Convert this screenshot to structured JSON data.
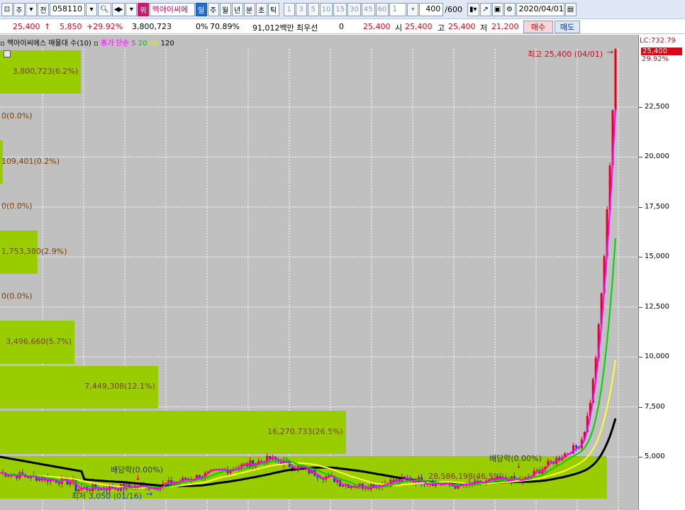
{
  "toolbar": {
    "market": "주",
    "prev": "전",
    "code": "058110",
    "warn": "위",
    "stock_name": "멕아이씨에",
    "periods": [
      "일",
      "주",
      "월",
      "년",
      "분",
      "초",
      "틱"
    ],
    "intervals": [
      "1",
      "3",
      "5",
      "10",
      "15",
      "30",
      "45",
      "60"
    ],
    "count_select": "1",
    "bar_count": "400",
    "bar_total": "/600",
    "date": "2020/04/01"
  },
  "quote": {
    "price": "25,400",
    "change": "5,850",
    "change_pct": "+29.92%",
    "volume": "3,800,723",
    "turnover_label": "0%",
    "turnover": "70.89%",
    "amount": "91,012백만",
    "best_quote": "최우선",
    "best_qty": "0",
    "best_price": "25,400",
    "open_label": "시",
    "open": "25,400",
    "high_label": "고",
    "high": "25,400",
    "low_label": "저",
    "low": "21,200",
    "buy_label": "매수",
    "sell_label": "매도"
  },
  "legend": {
    "title": "멕아이씨에스 매물대 수(10)",
    "ma_type": "종가 단순",
    "ma_periods": [
      "5",
      "20",
      "60",
      "120"
    ],
    "colors": {
      "ma5": "#ff00ff",
      "ma20": "#00c000",
      "ma60": "#e6e600",
      "ma120": "#000000"
    }
  },
  "axis": {
    "lc": "LC:732.79",
    "price_tag": "25,400",
    "pct": "29.92%",
    "ticks": [
      "22,500",
      "20,000",
      "17,500",
      "15,000",
      "12,500",
      "10,000",
      "7,500",
      "5,000"
    ]
  },
  "annotations": {
    "high": "최고 25,400 (04/01)",
    "low": "최저 3,050 (01/16)",
    "dividend1": "배당락(0.00%)",
    "dividend2": "배당락(0.00%)",
    "low_band_overlap": "28,586,198(46.5%)(  397,  0  ,175,0%)"
  },
  "chart_data": {
    "type": "volume-profile",
    "title": "멕아이씨에스 매물대 수(10)",
    "ylim": [
      2500,
      26000
    ],
    "y_ticks": [
      22500,
      20000,
      17500,
      15000,
      12500,
      10000,
      7500,
      5000
    ],
    "bands": [
      {
        "label": "3,800,723(6.2%)",
        "volume": 3800723,
        "pct": 6.2
      },
      {
        "label": "0(0.0%)",
        "volume": 0,
        "pct": 0.0
      },
      {
        "label": "109,401(0.2%)",
        "volume": 109401,
        "pct": 0.2
      },
      {
        "label": "0(0.0%)",
        "volume": 0,
        "pct": 0.0
      },
      {
        "label": "1,753,380(2.9%)",
        "volume": 1753380,
        "pct": 2.9
      },
      {
        "label": "0(0.0%)",
        "volume": 0,
        "pct": 0.0
      },
      {
        "label": "3,496,660(5.7%)",
        "volume": 3496660,
        "pct": 5.7
      },
      {
        "label": "7,449,308(12.1%)",
        "volume": 7449308,
        "pct": 12.1
      },
      {
        "label": "16,270,733(26.5%)",
        "volume": 16270733,
        "pct": 26.5
      },
      {
        "label": "28,586,198(46.5%)",
        "volume": 28586198,
        "pct": 46.5
      }
    ],
    "high": 25400,
    "low": 3050,
    "last_close": 25400
  }
}
